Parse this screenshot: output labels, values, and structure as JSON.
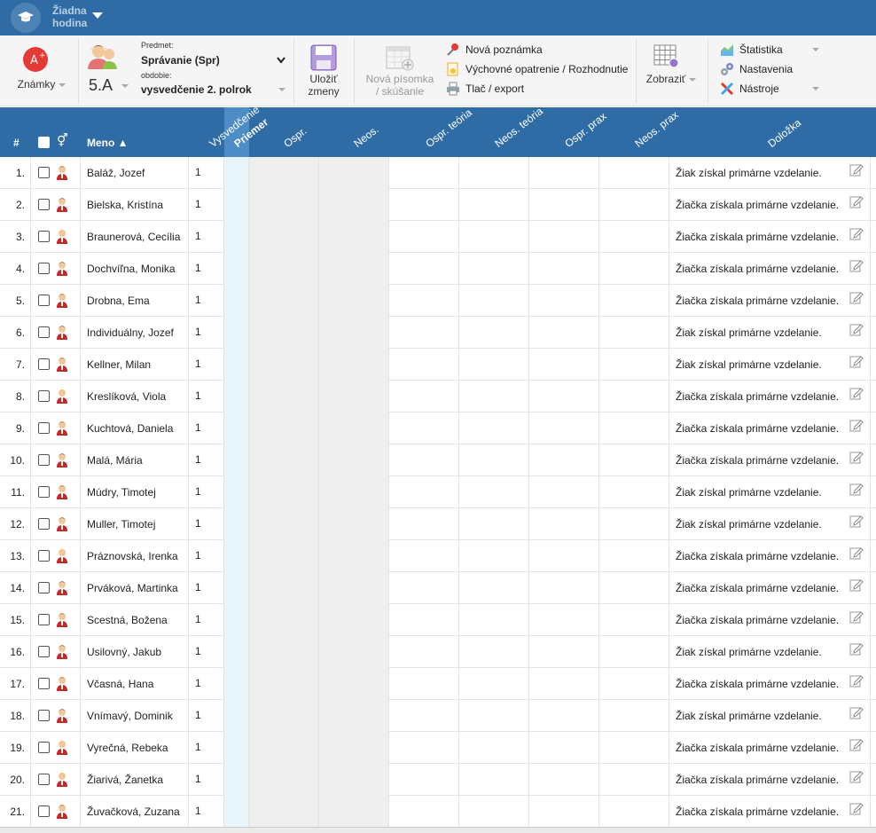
{
  "topbar": {
    "title_line1": "Žiadna",
    "title_line2": "hodina"
  },
  "toolbar": {
    "znamky_label": "Známky",
    "class_label": "5.A",
    "predmet_label": "Predmet:",
    "predmet_value": "Správanie (Spr)",
    "obdobie_label": "obdobie:",
    "obdobie_value": "vysvedčenie 2. polrok",
    "save_line1": "Uložiť",
    "save_line2": "zmeny",
    "test_line1": "Nová písomka",
    "test_line2": "/ skúšanie",
    "nova_poznamka": "Nová poznámka",
    "vychovne": "Výchovné opatrenie / Rozhodnutie",
    "tlac": "Tlač / export",
    "zobrazit": "Zobraziť",
    "statistika": "Štatistika",
    "nastavenia": "Nastavenia",
    "nastroje": "Nástroje"
  },
  "header": {
    "num": "#",
    "meno": "Meno ▲",
    "columns": [
      "Vysvedčenie",
      "Priemer",
      "Ospr.",
      "Neos.",
      "Ospr. teória",
      "Neos. teória",
      "Ospr. prax",
      "Neos. prax"
    ],
    "dolozka": "Doložka"
  },
  "colors": {
    "accent": "#2f6ca5",
    "priemer": "#e8f6fc",
    "grey_col": "#efefef"
  },
  "students": [
    {
      "num": "1.",
      "name": "Baláž, Jozef",
      "grade": "1",
      "note": "Žiak získal primárne vzdelanie.",
      "gender": "m"
    },
    {
      "num": "2.",
      "name": "Bielska, Kristína",
      "grade": "1",
      "note": "Žiačka získala primárne vzdelanie.",
      "gender": "m"
    },
    {
      "num": "3.",
      "name": "Braunerová, Cecília",
      "grade": "1",
      "note": "Žiačka získala primárne vzdelanie.",
      "gender": "f"
    },
    {
      "num": "4.",
      "name": "Dochvíľna, Monika",
      "grade": "1",
      "note": "Žiačka získala primárne vzdelanie.",
      "gender": "m"
    },
    {
      "num": "5.",
      "name": "Drobna, Ema",
      "grade": "1",
      "note": "Žiačka získala primárne vzdelanie.",
      "gender": "m"
    },
    {
      "num": "6.",
      "name": "Individuálny, Jozef",
      "grade": "1",
      "note": "Žiak získal primárne vzdelanie.",
      "gender": "m"
    },
    {
      "num": "7.",
      "name": "Kellner, Milan",
      "grade": "1",
      "note": "Žiak získal primárne vzdelanie.",
      "gender": "m"
    },
    {
      "num": "8.",
      "name": "Kreslíková, Viola",
      "grade": "1",
      "note": "Žiačka získala primárne vzdelanie.",
      "gender": "f"
    },
    {
      "num": "9.",
      "name": "Kuchtová, Daniela",
      "grade": "1",
      "note": "Žiačka získala primárne vzdelanie.",
      "gender": "m"
    },
    {
      "num": "10.",
      "name": "Malá, Mária",
      "grade": "1",
      "note": "Žiačka získala primárne vzdelanie.",
      "gender": "m"
    },
    {
      "num": "11.",
      "name": "Múdry, Timotej",
      "grade": "1",
      "note": "Žiak získal primárne vzdelanie.",
      "gender": "m"
    },
    {
      "num": "12.",
      "name": "Muller, Timotej",
      "grade": "1",
      "note": "Žiak získal primárne vzdelanie.",
      "gender": "m"
    },
    {
      "num": "13.",
      "name": "Práznovská, Irenka",
      "grade": "1",
      "note": "Žiačka získala primárne vzdelanie.",
      "gender": "f"
    },
    {
      "num": "14.",
      "name": "Prváková, Martinka",
      "grade": "1",
      "note": "Žiačka získala primárne vzdelanie.",
      "gender": "m"
    },
    {
      "num": "15.",
      "name": "Scestná, Božena",
      "grade": "1",
      "note": "Žiačka získala primárne vzdelanie.",
      "gender": "m"
    },
    {
      "num": "16.",
      "name": "Usilovný, Jakub",
      "grade": "1",
      "note": "Žiak získal primárne vzdelanie.",
      "gender": "m"
    },
    {
      "num": "17.",
      "name": "Včasná, Hana",
      "grade": "1",
      "note": "Žiačka získala primárne vzdelanie.",
      "gender": "m"
    },
    {
      "num": "18.",
      "name": "Vnímavý, Dominik",
      "grade": "1",
      "note": "Žiak získal primárne vzdelanie.",
      "gender": "m"
    },
    {
      "num": "19.",
      "name": "Vyrečná, Rebeka",
      "grade": "1",
      "note": "Žiačka získala primárne vzdelanie.",
      "gender": "f"
    },
    {
      "num": "20.",
      "name": "Žiarivá, Žanetka",
      "grade": "1",
      "note": "Žiačka získala primárne vzdelanie.",
      "gender": "f"
    },
    {
      "num": "21.",
      "name": "Žuvačková, Zuzana",
      "grade": "1",
      "note": "Žiačka získala primárne vzdelanie.",
      "gender": "m"
    }
  ]
}
